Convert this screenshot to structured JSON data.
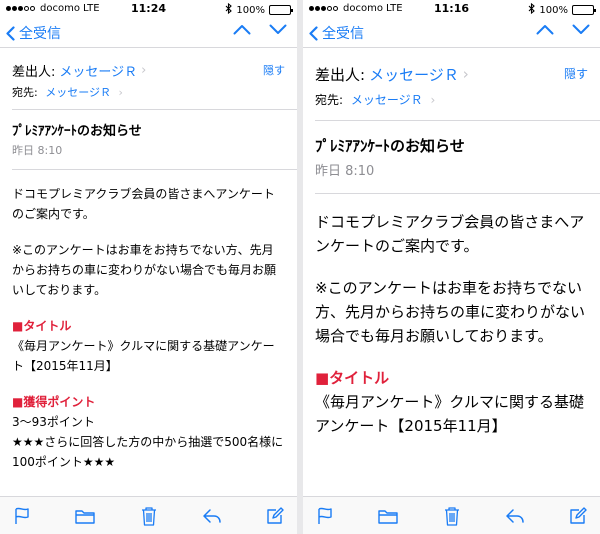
{
  "left": {
    "status": {
      "carrier": "docomo",
      "network": "LTE",
      "time": "11:24",
      "battery": "100%"
    },
    "nav": {
      "back_label": "全受信"
    },
    "header": {
      "from_label": "差出人:",
      "from_name": "メッセージＲ",
      "to_label": "宛先:",
      "to_name": "メッセージＲ",
      "hide_label": "隠す"
    },
    "subject": "ﾌﾟﾚﾐｱｱﾝｹｰﾄのお知らせ",
    "date": "昨日 8:10",
    "body": {
      "p1": "ドコモプレミアクラブ会員の皆さまへアンケートのご案内です。",
      "p2": "※このアンケートはお車をお持ちでない方、先月からお持ちの車に変わりがない場合でも毎月お願いしております。",
      "h1": "■タイトル",
      "p3": "《毎月アンケート》クルマに関する基礎アンケート【2015年11月】",
      "h2": "■獲得ポイント",
      "p4": "3～93ポイント",
      "p5": "★★★さらに回答した方の中から抽選で500名様に100ポイント★★★"
    }
  },
  "right": {
    "status": {
      "carrier": "docomo",
      "network": "LTE",
      "time": "11:16",
      "battery": "100%"
    },
    "nav": {
      "back_label": "全受信"
    },
    "header": {
      "from_label": "差出人:",
      "from_name": "メッセージＲ",
      "to_label": "宛先:",
      "to_name": "メッセージＲ",
      "hide_label": "隠す"
    },
    "subject": "ﾌﾟﾚﾐｱｱﾝｹｰﾄのお知らせ",
    "date": "昨日 8:10",
    "body": {
      "p1": "ドコモプレミアクラブ会員の皆さまへアンケートのご案内です。",
      "p2": "※このアンケートはお車をお持ちでない方、先月からお持ちの車に変わりがない場合でも毎月お願いしております。",
      "h1": "■タイトル",
      "p3": "《毎月アンケート》クルマに関する基礎アンケート【2015年11月】"
    }
  },
  "colors": {
    "accent": "#1a7cf5",
    "heading_red": "#e0213b",
    "secondary_text": "#8e8e93"
  },
  "icons": [
    "signal-dots-icon",
    "bluetooth-icon",
    "battery-icon",
    "back-chevron-icon",
    "up-arrow-icon",
    "down-arrow-icon",
    "flag-icon",
    "folder-icon",
    "trash-icon",
    "reply-icon",
    "compose-icon"
  ]
}
